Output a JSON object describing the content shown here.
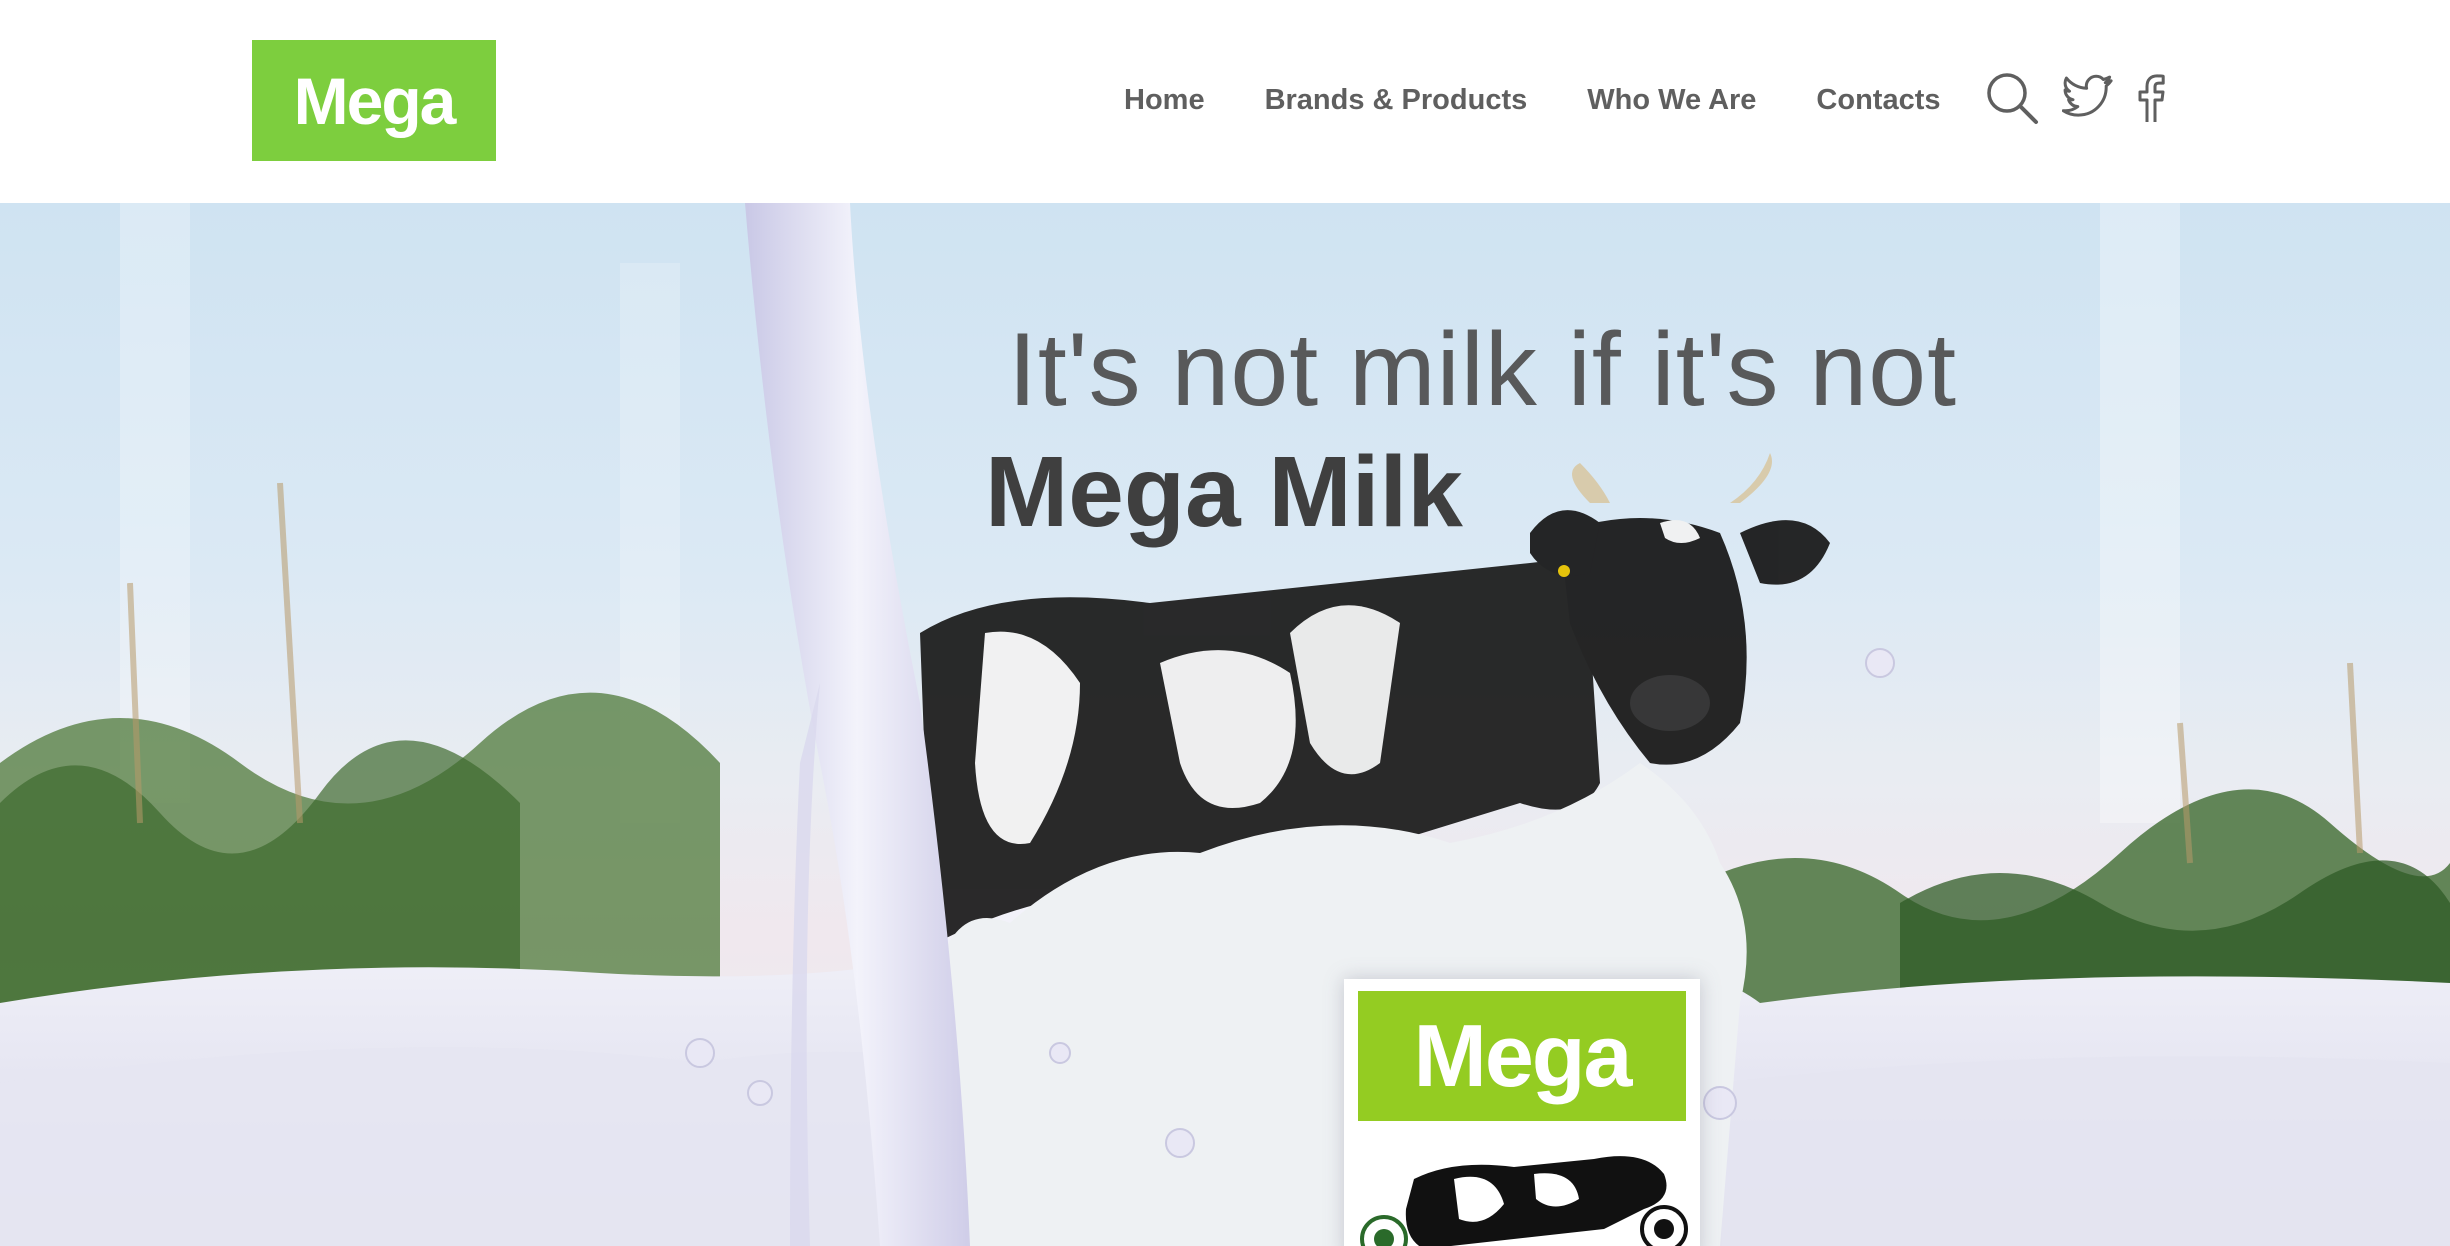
{
  "colors": {
    "brand": "#7dce3e",
    "pack_brand": "#94cc22",
    "nav_text": "#5f5f5f"
  },
  "header": {
    "logo_text": "Mega",
    "nav": [
      {
        "label": "Home"
      },
      {
        "label": "Brands & Products"
      },
      {
        "label": "Who We Are"
      },
      {
        "label": "Contacts"
      }
    ],
    "icons": [
      "search-icon",
      "twitter-icon",
      "facebook-icon"
    ]
  },
  "hero": {
    "headline_line1": "It's not milk if it's not",
    "headline_line2": "Mega Milk",
    "pack_brand_text": "Mega"
  }
}
